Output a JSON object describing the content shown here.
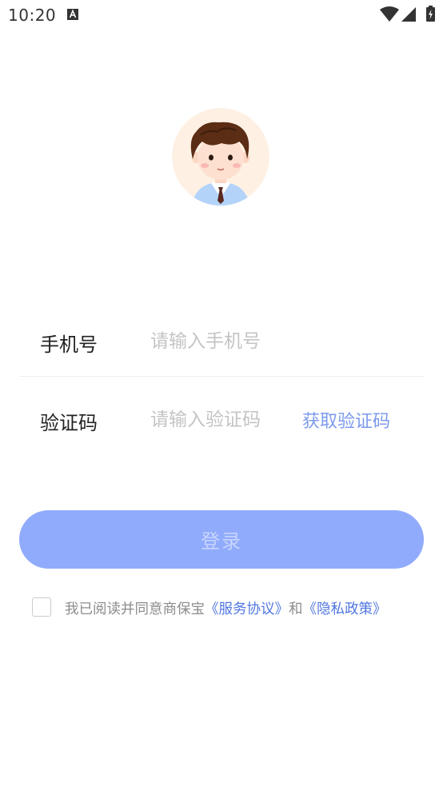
{
  "status_bar": {
    "time": "10:20",
    "notification_icon": "a-icon",
    "wifi_icon": "wifi-icon",
    "signal_icon": "signal-icon",
    "battery_icon": "battery-charging-icon"
  },
  "avatar": {
    "icon": "cartoon-boy-avatar"
  },
  "form": {
    "phone": {
      "label": "手机号",
      "value": "",
      "placeholder": "请输入手机号"
    },
    "code": {
      "label": "验证码",
      "value": "",
      "placeholder": "请输入验证码",
      "get_code_label": "获取验证码"
    }
  },
  "login": {
    "label": "登录"
  },
  "agreement": {
    "prefix": "我已阅读并同意商保宝",
    "service_link": "《服务协议》",
    "and": "和",
    "privacy_link": "《隐私政策》",
    "checked": false
  },
  "colors": {
    "accent": "#91abfc",
    "link": "#5077e0",
    "get_code": "#7d9aec"
  }
}
